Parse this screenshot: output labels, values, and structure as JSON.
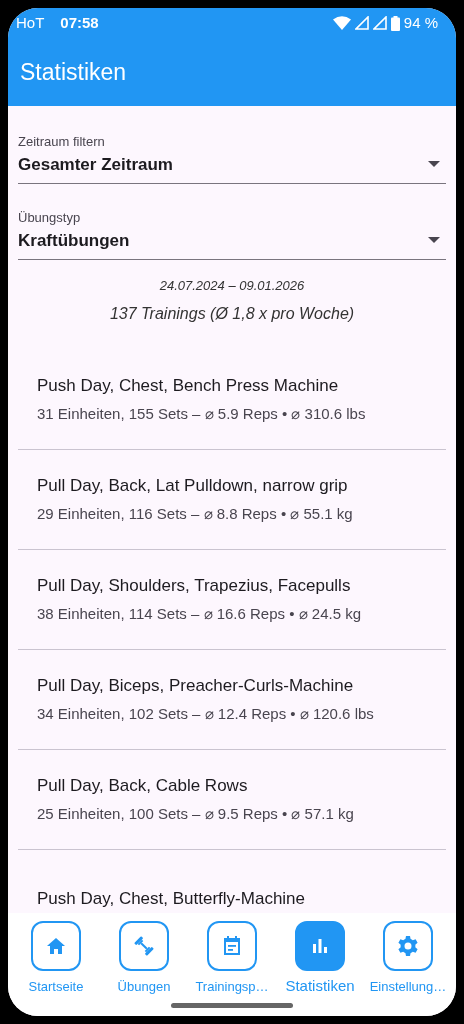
{
  "status_bar": {
    "carrier": "HoT",
    "time": "07:58",
    "battery": "94 %"
  },
  "app_bar": {
    "title": "Statistiken"
  },
  "filters": [
    {
      "label": "Zeitraum filtern",
      "value": "Gesamter Zeitraum"
    },
    {
      "label": "Übungstyp",
      "value": "Kraftübungen"
    }
  ],
  "summary": {
    "date_range": "24.07.2024 – 09.01.2026",
    "trainings": "137 Trainings (Ø 1,8 x pro Woche)"
  },
  "exercises": [
    {
      "title": "Push Day, Chest, Bench Press Machine",
      "details": "31 Einheiten, 155 Sets – ⌀ 5.9 Reps • ⌀ 310.6 lbs"
    },
    {
      "title": "Pull Day, Back, Lat Pulldown, narrow grip",
      "details": "29 Einheiten, 116 Sets – ⌀ 8.8 Reps • ⌀ 55.1 kg"
    },
    {
      "title": "Pull Day, Shoulders, Trapezius, Facepulls",
      "details": "38 Einheiten, 114 Sets – ⌀ 16.6 Reps • ⌀ 24.5 kg"
    },
    {
      "title": "Pull Day, Biceps, Preacher-Curls-Machine",
      "details": "34 Einheiten, 102 Sets – ⌀ 12.4 Reps • ⌀ 120.6 lbs"
    },
    {
      "title": "Pull Day, Back, Cable Rows",
      "details": "25 Einheiten, 100 Sets – ⌀ 9.5 Reps • ⌀ 57.1 kg"
    },
    {
      "title": "Push Day, Chest, Butterfly-Machine"
    }
  ],
  "bottom_nav": [
    {
      "label": "Startseite",
      "kind": "home",
      "selected": false
    },
    {
      "label": "Übungen",
      "kind": "dumbbell",
      "selected": false
    },
    {
      "label": "Trainingsp…",
      "kind": "calendar",
      "selected": false
    },
    {
      "label": "Statistiken",
      "kind": "chart",
      "selected": true
    },
    {
      "label": "Einstellung…",
      "kind": "gear",
      "selected": false
    }
  ]
}
